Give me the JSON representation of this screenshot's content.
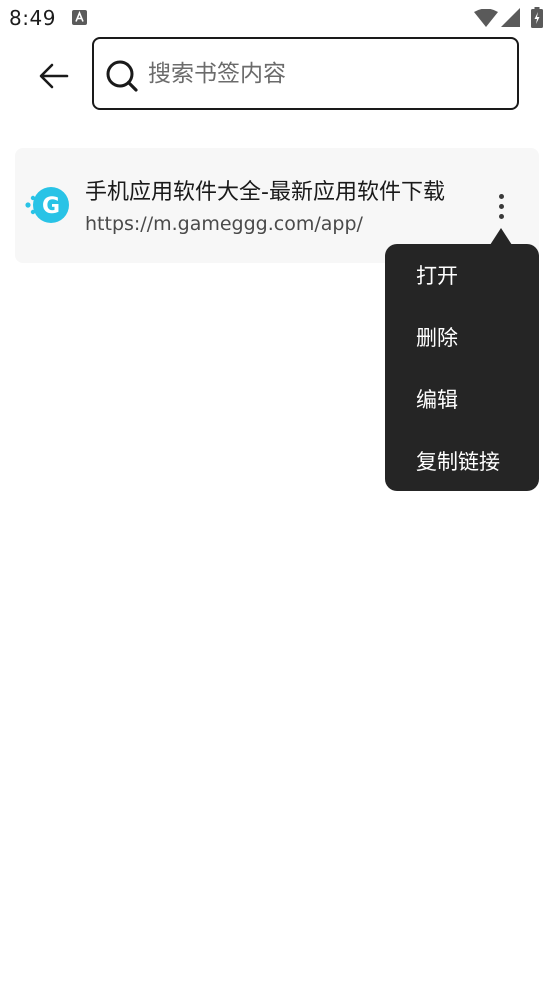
{
  "status_bar": {
    "time": "8:49",
    "icons": [
      "notification-a-icon",
      "wifi-icon",
      "signal-icon",
      "battery-charging-icon"
    ]
  },
  "header": {
    "back_icon": "arrow-left-icon",
    "search": {
      "placeholder": "搜索书签内容",
      "value": "",
      "icon": "search-icon"
    }
  },
  "bookmarks": [
    {
      "title": "手机应用软件大全-最新应用软件下载",
      "url": "https://m.gameggg.com/app/",
      "logo_icon": "gameggg-logo-icon",
      "more_icon": "more-vertical-icon"
    }
  ],
  "popup_menu": {
    "items": [
      "打开",
      "删除",
      "编辑",
      "复制链接"
    ]
  },
  "colors": {
    "card_bg": "#f7f7f7",
    "menu_bg": "#252525",
    "logo_cyan": "#29c3e6",
    "text_primary": "#1a1a1a",
    "text_secondary": "#4a4a4a"
  }
}
